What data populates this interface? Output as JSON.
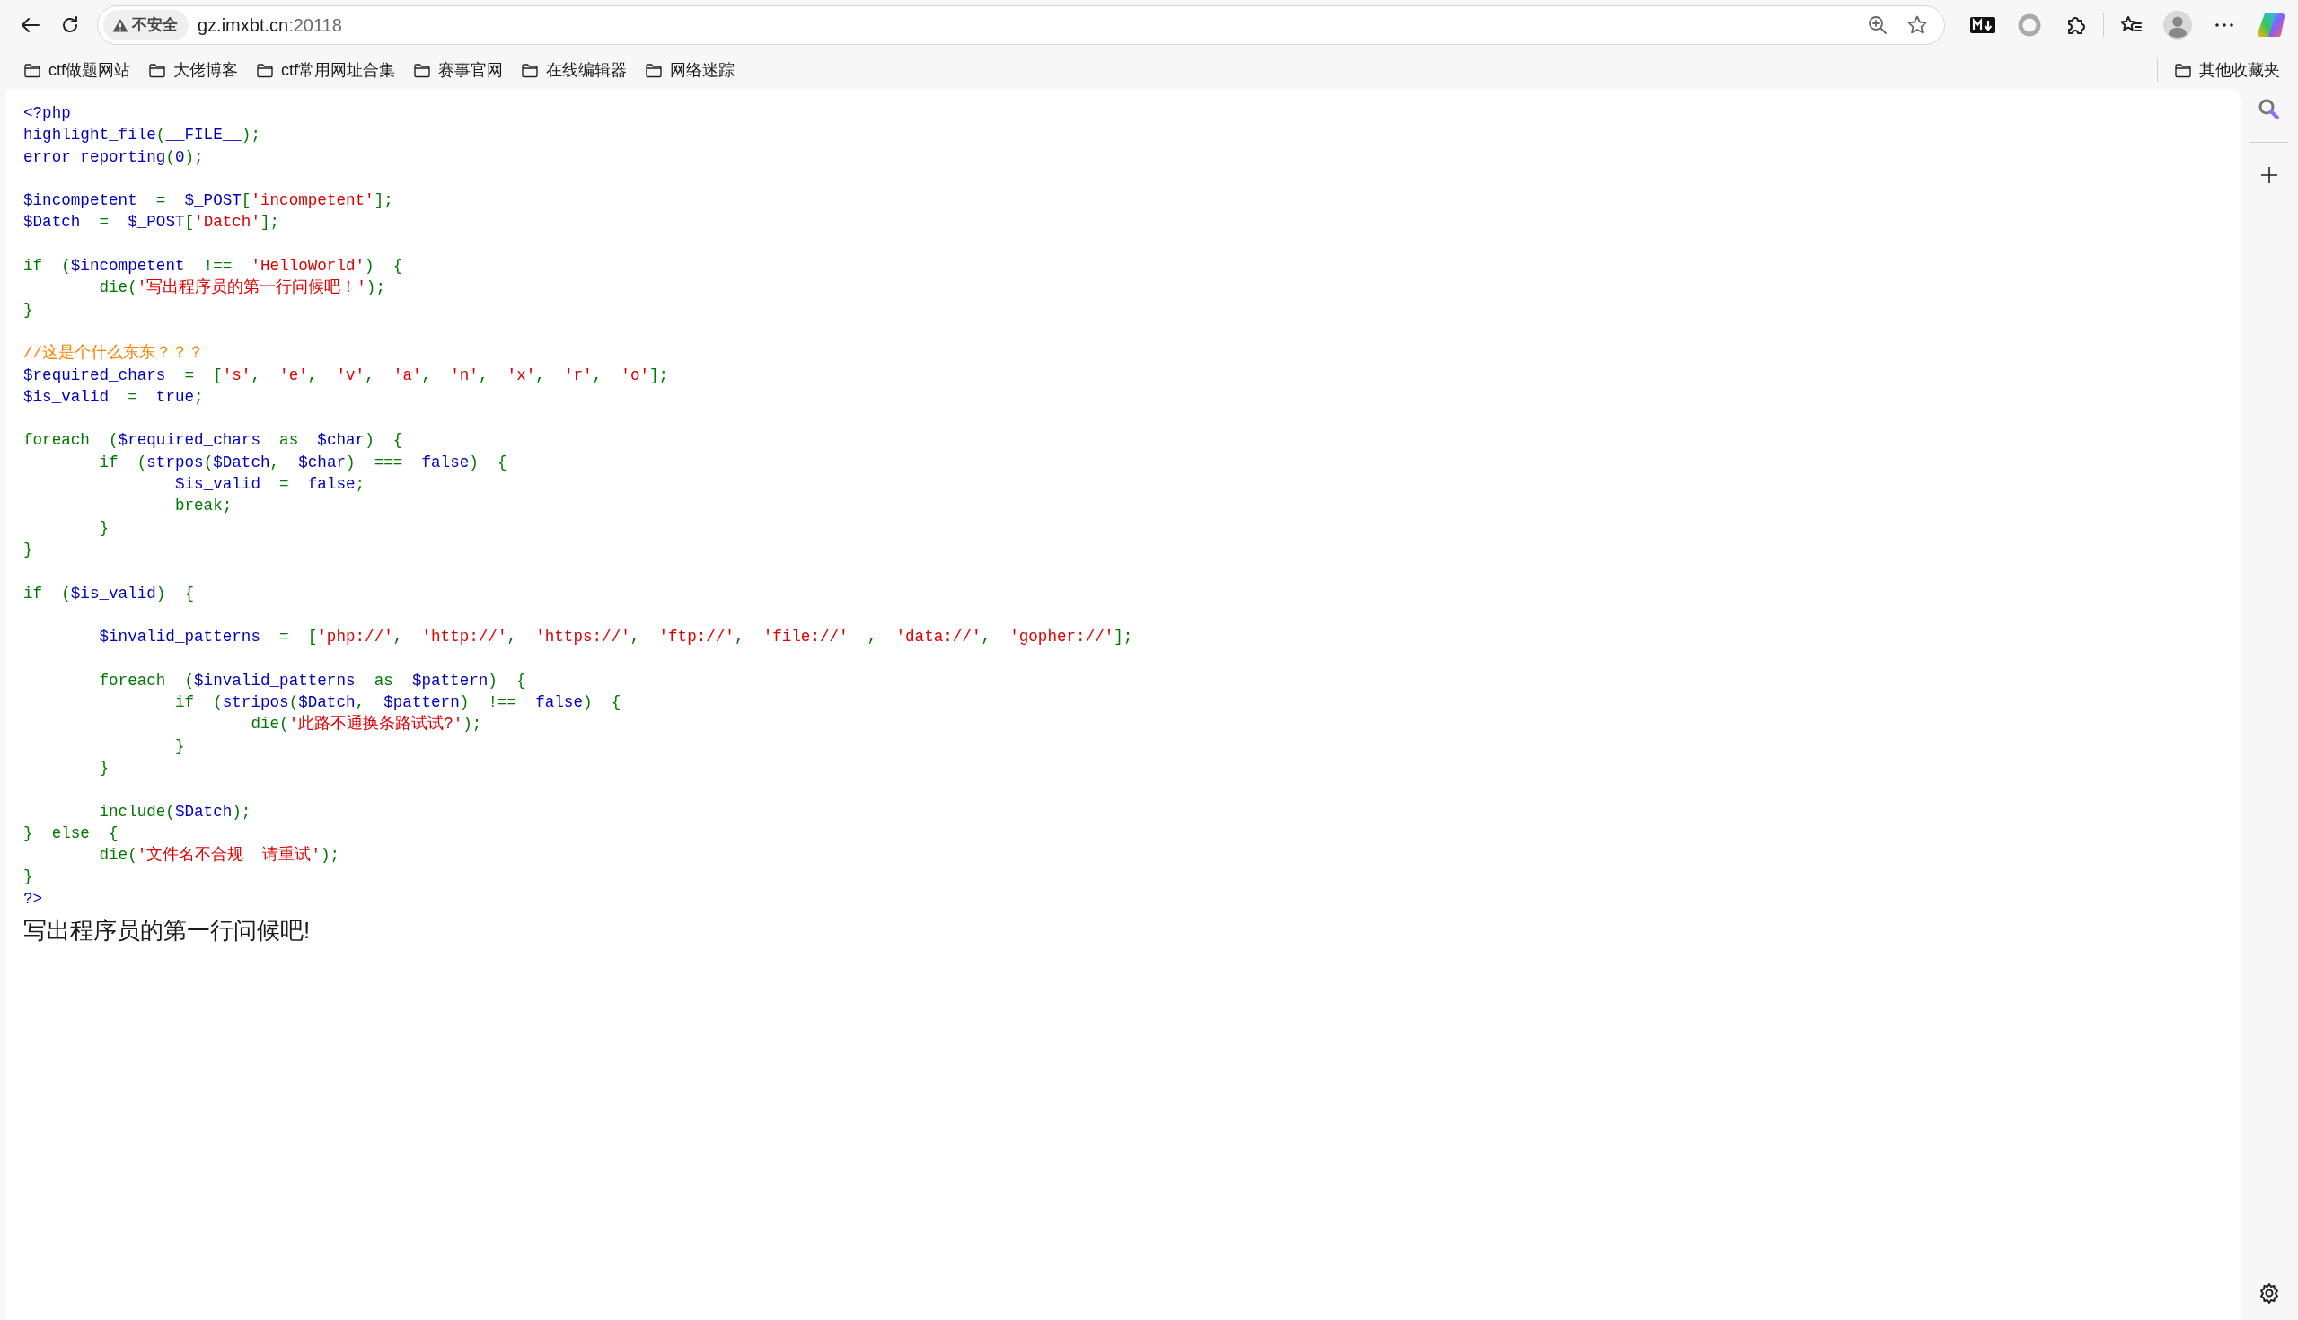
{
  "toolbar": {
    "security_label": "不安全",
    "url_host": "gz.imxbt.cn",
    "url_port": ":20118"
  },
  "bookmarks": [
    {
      "label": "ctf做题网站"
    },
    {
      "label": "大佬博客"
    },
    {
      "label": "ctf常用网址合集"
    },
    {
      "label": "赛事官网"
    },
    {
      "label": "在线编辑器"
    },
    {
      "label": "网络迷踪"
    }
  ],
  "other_bookmarks": {
    "label": "其他收藏夹"
  },
  "code_blocks": [
    [
      [
        {
          "kind": "default",
          "text": "<?php"
        }
      ],
      [
        {
          "kind": "default",
          "text": "highlight_file"
        },
        {
          "kind": "keyword",
          "text": "("
        },
        {
          "kind": "default",
          "text": "__FILE__"
        },
        {
          "kind": "keyword",
          "text": ");"
        }
      ],
      [
        {
          "kind": "default",
          "text": "error_reporting"
        },
        {
          "kind": "keyword",
          "text": "("
        },
        {
          "kind": "default",
          "text": "0"
        },
        {
          "kind": "keyword",
          "text": ");"
        }
      ]
    ],
    [
      [
        {
          "kind": "default",
          "text": "$incompetent  "
        },
        {
          "kind": "keyword",
          "text": "=  "
        },
        {
          "kind": "default",
          "text": "$_POST"
        },
        {
          "kind": "keyword",
          "text": "["
        },
        {
          "kind": "string",
          "text": "'incompetent'"
        },
        {
          "kind": "keyword",
          "text": "];"
        }
      ],
      [
        {
          "kind": "default",
          "text": "$Datch  "
        },
        {
          "kind": "keyword",
          "text": "=  "
        },
        {
          "kind": "default",
          "text": "$_POST"
        },
        {
          "kind": "keyword",
          "text": "["
        },
        {
          "kind": "string",
          "text": "'Datch'"
        },
        {
          "kind": "keyword",
          "text": "];"
        }
      ]
    ],
    [
      [
        {
          "kind": "keyword",
          "text": "if  ("
        },
        {
          "kind": "default",
          "text": "$incompetent  "
        },
        {
          "kind": "keyword",
          "text": "!==  "
        },
        {
          "kind": "string",
          "text": "'HelloWorld'"
        },
        {
          "kind": "keyword",
          "text": ")  {"
        }
      ],
      [
        {
          "kind": "keyword",
          "text": "        die("
        },
        {
          "kind": "string",
          "text": "'写出程序员的第一行问候吧！'"
        },
        {
          "kind": "keyword",
          "text": ");"
        }
      ],
      [
        {
          "kind": "keyword",
          "text": "}"
        }
      ]
    ],
    [
      [
        {
          "kind": "comment",
          "text": "//这是个什么东东？？？"
        }
      ],
      [
        {
          "kind": "default",
          "text": "$required_chars  "
        },
        {
          "kind": "keyword",
          "text": "=  ["
        },
        {
          "kind": "string",
          "text": "'s'"
        },
        {
          "kind": "keyword",
          "text": ",  "
        },
        {
          "kind": "string",
          "text": "'e'"
        },
        {
          "kind": "keyword",
          "text": ",  "
        },
        {
          "kind": "string",
          "text": "'v'"
        },
        {
          "kind": "keyword",
          "text": ",  "
        },
        {
          "kind": "string",
          "text": "'a'"
        },
        {
          "kind": "keyword",
          "text": ",  "
        },
        {
          "kind": "string",
          "text": "'n'"
        },
        {
          "kind": "keyword",
          "text": ",  "
        },
        {
          "kind": "string",
          "text": "'x'"
        },
        {
          "kind": "keyword",
          "text": ",  "
        },
        {
          "kind": "string",
          "text": "'r'"
        },
        {
          "kind": "keyword",
          "text": ",  "
        },
        {
          "kind": "string",
          "text": "'o'"
        },
        {
          "kind": "keyword",
          "text": "];"
        }
      ],
      [
        {
          "kind": "default",
          "text": "$is_valid  "
        },
        {
          "kind": "keyword",
          "text": "=  "
        },
        {
          "kind": "default",
          "text": "true"
        },
        {
          "kind": "keyword",
          "text": ";"
        }
      ]
    ],
    [
      [
        {
          "kind": "keyword",
          "text": "foreach  ("
        },
        {
          "kind": "default",
          "text": "$required_chars  "
        },
        {
          "kind": "keyword",
          "text": "as  "
        },
        {
          "kind": "default",
          "text": "$char"
        },
        {
          "kind": "keyword",
          "text": ")  {"
        }
      ],
      [
        {
          "kind": "keyword",
          "text": "        if  ("
        },
        {
          "kind": "default",
          "text": "strpos"
        },
        {
          "kind": "keyword",
          "text": "("
        },
        {
          "kind": "default",
          "text": "$Datch"
        },
        {
          "kind": "keyword",
          "text": ",  "
        },
        {
          "kind": "default",
          "text": "$char"
        },
        {
          "kind": "keyword",
          "text": ")  ===  "
        },
        {
          "kind": "default",
          "text": "false"
        },
        {
          "kind": "keyword",
          "text": ")  {"
        }
      ],
      [
        {
          "kind": "default",
          "text": "                $is_valid  "
        },
        {
          "kind": "keyword",
          "text": "=  "
        },
        {
          "kind": "default",
          "text": "false"
        },
        {
          "kind": "keyword",
          "text": ";"
        }
      ],
      [
        {
          "kind": "keyword",
          "text": "                break;"
        }
      ],
      [
        {
          "kind": "keyword",
          "text": "        }"
        }
      ],
      [
        {
          "kind": "keyword",
          "text": "}"
        }
      ]
    ],
    [
      [
        {
          "kind": "keyword",
          "text": "if  ("
        },
        {
          "kind": "default",
          "text": "$is_valid"
        },
        {
          "kind": "keyword",
          "text": ")  {"
        }
      ]
    ],
    [
      [
        {
          "kind": "default",
          "text": "        $invalid_patterns  "
        },
        {
          "kind": "keyword",
          "text": "=  ["
        },
        {
          "kind": "string",
          "text": "'php://'"
        },
        {
          "kind": "keyword",
          "text": ",  "
        },
        {
          "kind": "string",
          "text": "'http://'"
        },
        {
          "kind": "keyword",
          "text": ",  "
        },
        {
          "kind": "string",
          "text": "'https://'"
        },
        {
          "kind": "keyword",
          "text": ",  "
        },
        {
          "kind": "string",
          "text": "'ftp://'"
        },
        {
          "kind": "keyword",
          "text": ",  "
        },
        {
          "kind": "string",
          "text": "'file://'"
        },
        {
          "kind": "keyword",
          "text": "  ,  "
        },
        {
          "kind": "string",
          "text": "'data://'"
        },
        {
          "kind": "keyword",
          "text": ",  "
        },
        {
          "kind": "string",
          "text": "'gopher://'"
        },
        {
          "kind": "keyword",
          "text": "];"
        }
      ]
    ],
    [
      [
        {
          "kind": "keyword",
          "text": "        foreach  ("
        },
        {
          "kind": "default",
          "text": "$invalid_patterns  "
        },
        {
          "kind": "keyword",
          "text": "as  "
        },
        {
          "kind": "default",
          "text": "$pattern"
        },
        {
          "kind": "keyword",
          "text": ")  {"
        }
      ],
      [
        {
          "kind": "keyword",
          "text": "                if  ("
        },
        {
          "kind": "default",
          "text": "stripos"
        },
        {
          "kind": "keyword",
          "text": "("
        },
        {
          "kind": "default",
          "text": "$Datch"
        },
        {
          "kind": "keyword",
          "text": ",  "
        },
        {
          "kind": "default",
          "text": "$pattern"
        },
        {
          "kind": "keyword",
          "text": ")  !==  "
        },
        {
          "kind": "default",
          "text": "false"
        },
        {
          "kind": "keyword",
          "text": ")  {"
        }
      ],
      [
        {
          "kind": "keyword",
          "text": "                        die("
        },
        {
          "kind": "string",
          "text": "'此路不通换条路试试?'"
        },
        {
          "kind": "keyword",
          "text": ");"
        }
      ],
      [
        {
          "kind": "keyword",
          "text": "                }"
        }
      ],
      [
        {
          "kind": "keyword",
          "text": "        }"
        }
      ]
    ],
    [
      [
        {
          "kind": "keyword",
          "text": "        include("
        },
        {
          "kind": "default",
          "text": "$Datch"
        },
        {
          "kind": "keyword",
          "text": ");"
        }
      ],
      [
        {
          "kind": "keyword",
          "text": "}  else  {"
        }
      ],
      [
        {
          "kind": "keyword",
          "text": "        die("
        },
        {
          "kind": "string",
          "text": "'文件名不合规  请重试'"
        },
        {
          "kind": "keyword",
          "text": ");"
        }
      ],
      [
        {
          "kind": "keyword",
          "text": "}"
        }
      ],
      [
        {
          "kind": "default",
          "text": "?>"
        }
      ]
    ]
  ],
  "output": "写出程序员的第一行问候吧!"
}
